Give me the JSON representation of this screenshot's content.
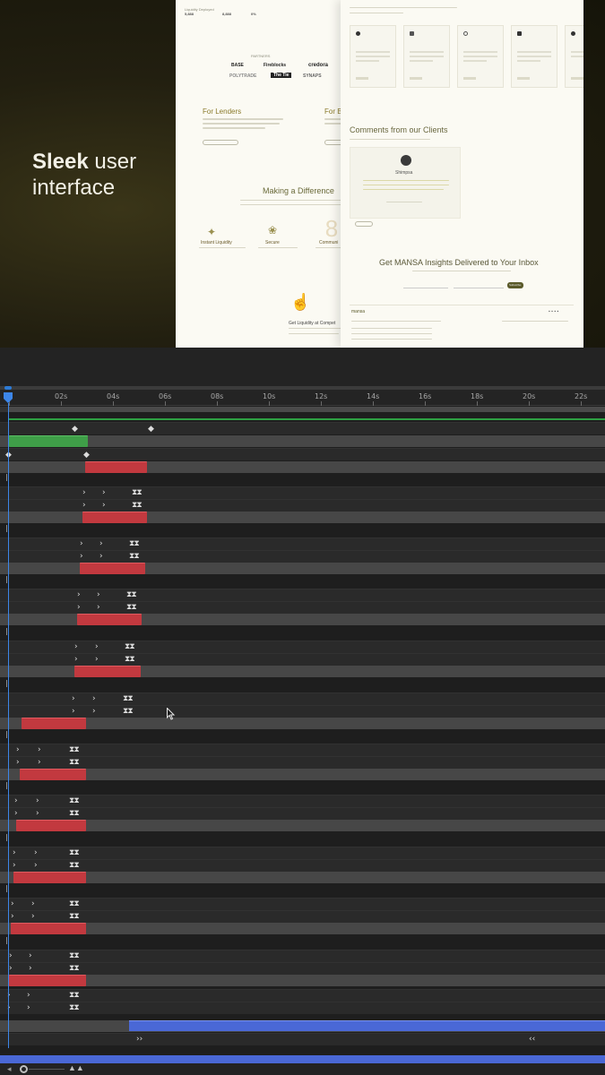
{
  "preview": {
    "headline_bold": "Sleek",
    "headline_rest_line1": " user",
    "headline_line2": "interface",
    "left_page": {
      "stats": [
        "5,888",
        "8,888",
        "0%"
      ],
      "partners_label": "PARTNERS",
      "logos": [
        "BASE",
        "Fireblocks",
        "credora",
        "POLYTRADE",
        "The Tie",
        "SYNAPS"
      ],
      "for_lenders": "For Lenders",
      "for_b": "For B",
      "making_difference": "Making a Difference",
      "features": [
        "Instant Liquidity",
        "Secure",
        "Communi"
      ],
      "footer_cta": "Get Liquidity at Compet"
    },
    "right_page": {
      "comments_heading": "Comments from our Clients",
      "client_name": "Shimpsa",
      "newsletter_heading": "Get MANSA Insights Delivered to Your Inbox",
      "subscribe_label": "Subscribe",
      "brand": "mansa"
    }
  },
  "timeline": {
    "ruler_labels": [
      "0s",
      "02s",
      "04s",
      "06s",
      "08s",
      "10s",
      "12s",
      "14s",
      "16s",
      "18s",
      "20s",
      "22s"
    ],
    "accent_colors": {
      "cti": "#3d86e8",
      "work_area_line": "#2ea043",
      "layer_red": "#c2393f",
      "layer_green": "#3f9e48",
      "layer_blue": "#4a68d6"
    },
    "icons": {
      "keyframe": "keyframe-arrow-icon",
      "easy_ease": "easy-ease-keyframe-icon",
      "zoom_out": "zoom-out-icon",
      "zoom_in": "zoom-in-icon"
    }
  }
}
